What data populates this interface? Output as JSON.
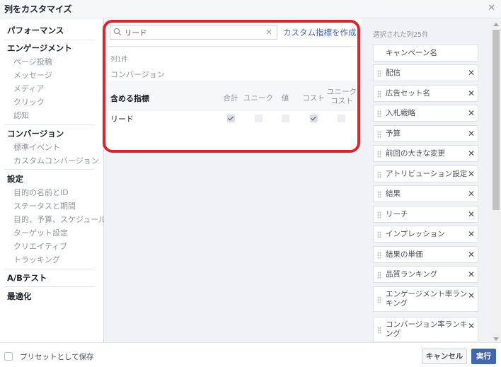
{
  "dialog": {
    "title": "列をカスタマイズ",
    "close_icon": "close-icon"
  },
  "sidebar": {
    "sections": [
      {
        "header": "パフォーマンス",
        "items": []
      },
      {
        "header": "エンゲージメント",
        "items": [
          "ページ投稿",
          "メッセージ",
          "メディア",
          "クリック",
          "認知"
        ]
      },
      {
        "header": "コンバージョン",
        "items": [
          "標準イベント",
          "カスタムコンバージョン"
        ]
      },
      {
        "header": "設定",
        "items": [
          "目的の名前とID",
          "ステータスと期間",
          "目的、予算、スケジュール",
          "ターゲット設定",
          "クリエイティブ",
          "トラッキング"
        ]
      },
      {
        "header": "A/Bテスト",
        "items": []
      },
      {
        "header": "最適化",
        "items": []
      }
    ]
  },
  "search": {
    "value": "リード",
    "icon": "search-icon",
    "clear_icon": "clear-icon"
  },
  "custom_metric_link": "カスタム指標を作成",
  "results": {
    "count_label": "列1件",
    "category": "コンバージョン",
    "header_label": "含める指標",
    "columns": [
      "合計",
      "ユニーク",
      "値",
      "コスト",
      "ユニーク\nコスト"
    ],
    "rows": [
      {
        "label": "リード",
        "checks": [
          true,
          false,
          false,
          true,
          false
        ]
      }
    ]
  },
  "selected": {
    "header": "選択された列25件",
    "items": [
      {
        "label": "キャンペーン名",
        "fixed": true
      },
      {
        "label": "配信"
      },
      {
        "label": "広告セット名"
      },
      {
        "label": "入札戦略"
      },
      {
        "label": "予算"
      },
      {
        "label": "前回の大きな変更"
      },
      {
        "label": "アトリビューション設定"
      },
      {
        "label": "結果"
      },
      {
        "label": "リーチ"
      },
      {
        "label": "インプレッション"
      },
      {
        "label": "結果の単価"
      },
      {
        "label": "品質ランキング"
      },
      {
        "label": "エンゲージメント率ランキング"
      },
      {
        "label": "コンバージョン率ランキング"
      }
    ]
  },
  "footer": {
    "save_preset_label": "プリセットとして保存",
    "cancel_label": "キャンセル",
    "run_label": "実行"
  },
  "colors": {
    "accent": "#4267b2",
    "highlight": "#e5202a"
  }
}
